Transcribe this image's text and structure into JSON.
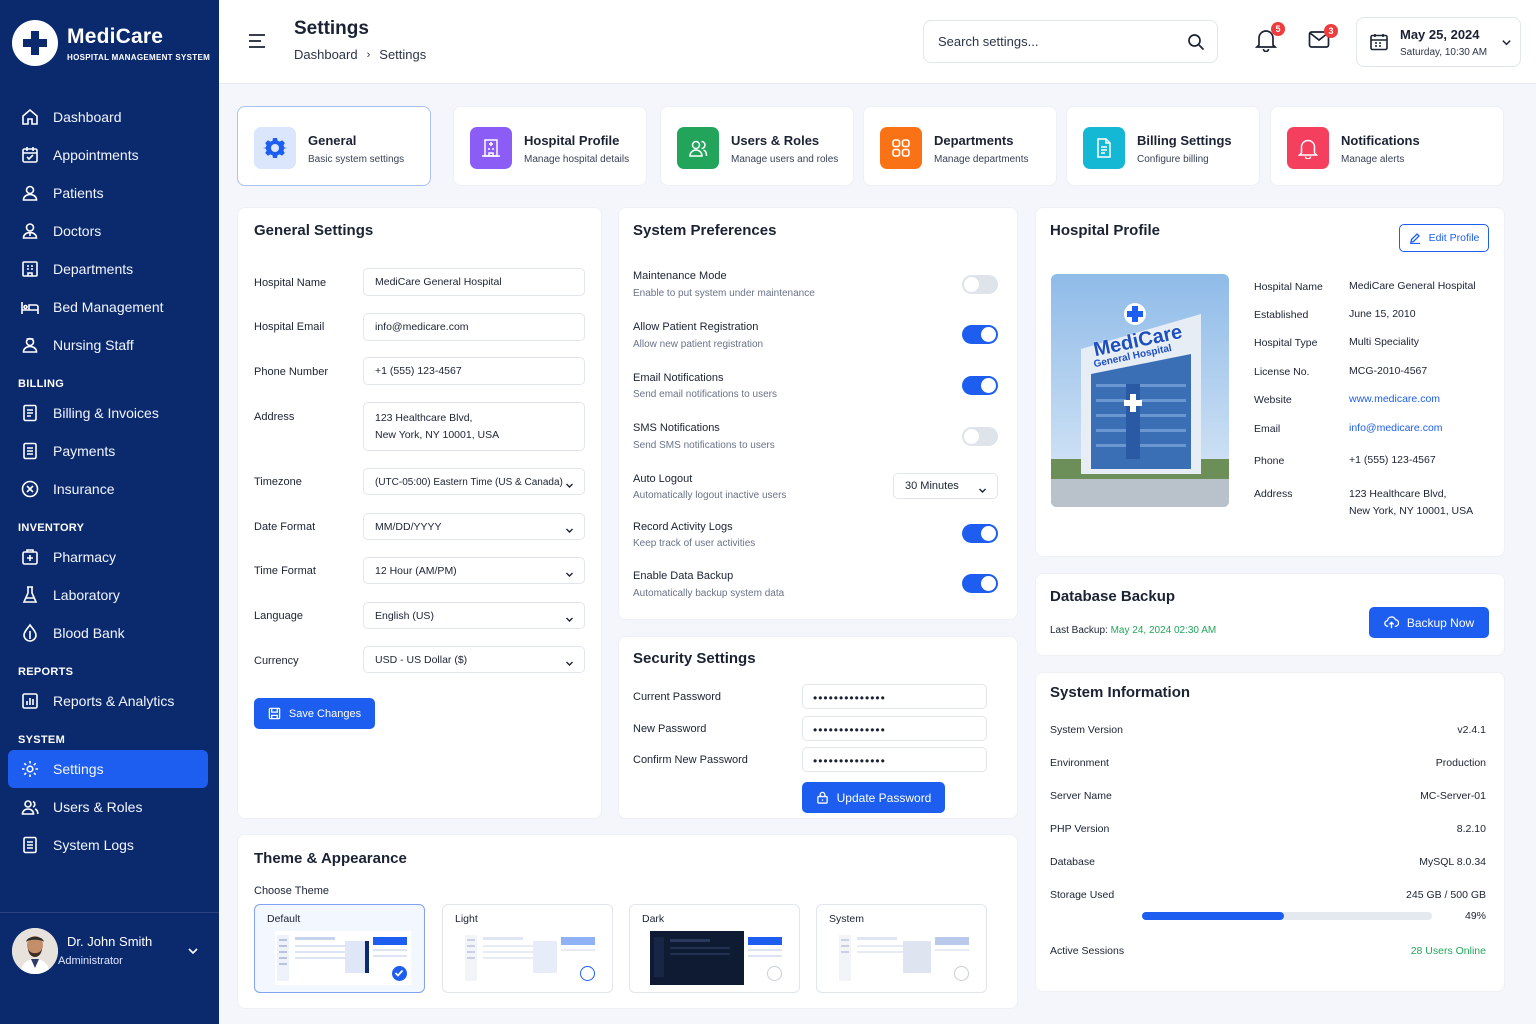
{
  "brand": {
    "name": "MediCare",
    "subtitle": "HOSPITAL MANAGEMENT SYSTEM"
  },
  "sidebar": {
    "main": [
      {
        "label": "Dashboard",
        "icon": "home-icon"
      },
      {
        "label": "Appointments",
        "icon": "calendar-icon"
      },
      {
        "label": "Patients",
        "icon": "user-icon"
      },
      {
        "label": "Doctors",
        "icon": "doctor-icon"
      },
      {
        "label": "Departments",
        "icon": "building-icon"
      },
      {
        "label": "Bed Management",
        "icon": "bed-icon"
      },
      {
        "label": "Nursing Staff",
        "icon": "nurse-icon"
      }
    ],
    "billing_title": "BILLING",
    "billing": [
      {
        "label": "Billing & Invoices",
        "icon": "invoice-icon"
      },
      {
        "label": "Payments",
        "icon": "receipt-icon"
      },
      {
        "label": "Insurance",
        "icon": "insurance-icon"
      }
    ],
    "inventory_title": "INVENTORY",
    "inventory": [
      {
        "label": "Pharmacy",
        "icon": "pharmacy-icon"
      },
      {
        "label": "Laboratory",
        "icon": "flask-icon"
      },
      {
        "label": "Blood Bank",
        "icon": "drop-icon"
      }
    ],
    "reports_title": "REPORTS",
    "reports": [
      {
        "label": "Reports & Analytics",
        "icon": "chart-icon"
      }
    ],
    "system_title": "SYSTEM",
    "system": [
      {
        "label": "Settings",
        "icon": "gear-icon"
      },
      {
        "label": "Users & Roles",
        "icon": "users-icon"
      },
      {
        "label": "System Logs",
        "icon": "log-icon"
      }
    ]
  },
  "user": {
    "name": "Dr. John Smith",
    "role": "Administrator"
  },
  "header": {
    "title": "Settings",
    "breadcrumb": [
      "Dashboard",
      "Settings"
    ],
    "search_placeholder": "Search settings...",
    "notifications_count": "5",
    "messages_count": "3",
    "date": "May 25, 2024",
    "datetime": "Saturday, 10:30 AM"
  },
  "tabs": [
    {
      "name": "General",
      "desc": "Basic system settings",
      "color": "#1d5ef0"
    },
    {
      "name": "Hospital Profile",
      "desc": "Manage hospital details",
      "color": "#8b5cf6"
    },
    {
      "name": "Users & Roles",
      "desc": "Manage users and roles",
      "color": "#22a55a"
    },
    {
      "name": "Departments",
      "desc": "Manage departments",
      "color": "#f97316"
    },
    {
      "name": "Billing Settings",
      "desc": "Configure billing",
      "color": "#14b8d4"
    },
    {
      "name": "Notifications",
      "desc": "Manage alerts",
      "color": "#f43f5e"
    }
  ],
  "general": {
    "title": "General Settings",
    "fields": [
      {
        "label": "Hospital Name",
        "value": "MediCare General Hospital"
      },
      {
        "label": "Hospital Email",
        "value": "info@medicare.com"
      },
      {
        "label": "Phone Number",
        "value": "+1 (555) 123-4567"
      },
      {
        "label": "Address",
        "line1": "123 Healthcare Blvd,",
        "line2": "New York, NY 10001, USA"
      },
      {
        "label": "Timezone",
        "value": "(UTC-05:00) Eastern Time (US & Canada)"
      },
      {
        "label": "Date Format",
        "value": "MM/DD/YYYY"
      },
      {
        "label": "Time Format",
        "value": "12 Hour (AM/PM)"
      },
      {
        "label": "Language",
        "value": "English (US)"
      },
      {
        "label": "Currency",
        "value": "USD - US Dollar ($)"
      }
    ],
    "save_label": "Save Changes"
  },
  "preferences": {
    "title": "System Preferences",
    "items": [
      {
        "name": "Maintenance Mode",
        "desc": "Enable to put system under maintenance",
        "on": false
      },
      {
        "name": "Allow Patient Registration",
        "desc": "Allow new patient registration",
        "on": true
      },
      {
        "name": "Email Notifications",
        "desc": "Send email notifications to users",
        "on": true
      },
      {
        "name": "SMS Notifications",
        "desc": "Send SMS notifications to users",
        "on": false
      },
      {
        "name": "Auto Logout",
        "desc": "Automatically logout inactive users",
        "select": "30 Minutes"
      },
      {
        "name": "Record Activity Logs",
        "desc": "Keep track of user activities",
        "on": true
      },
      {
        "name": "Enable Data Backup",
        "desc": "Automatically backup system data",
        "on": true
      }
    ]
  },
  "security": {
    "title": "Security Settings",
    "fields": [
      {
        "label": "Current Password",
        "value": "••••••••••••••"
      },
      {
        "label": "New Password",
        "value": "••••••••••••••"
      },
      {
        "label": "Confirm New Password",
        "value": "••••••••••••••"
      }
    ],
    "button": "Update Password"
  },
  "profile": {
    "title": "Hospital Profile",
    "edit_label": "Edit Profile",
    "image_title": "MediCare",
    "image_subtitle": "General Hospital",
    "rows": [
      {
        "label": "Hospital Name",
        "value": "MediCare General Hospital"
      },
      {
        "label": "Established",
        "value": "June 15, 2010"
      },
      {
        "label": "Hospital Type",
        "value": "Multi Speciality"
      },
      {
        "label": "License No.",
        "value": "MCG-2010-4567"
      },
      {
        "label": "Website",
        "value": "www.medicare.com"
      },
      {
        "label": "Email",
        "value": "info@medicare.com"
      },
      {
        "label": "Phone",
        "value": "+1 (555) 123-4567"
      },
      {
        "label": "Address",
        "line1": "123 Healthcare Blvd,",
        "line2": "New York, NY 10001, USA"
      }
    ]
  },
  "backup": {
    "title": "Database Backup",
    "last_label": "Last Backup:",
    "last_value": "May 24, 2024 02:30 AM",
    "button": "Backup Now"
  },
  "sysinfo": {
    "title": "System Information",
    "rows": [
      {
        "label": "System Version",
        "value": "v2.4.1"
      },
      {
        "label": "Environment",
        "value": "Production"
      },
      {
        "label": "Server Name",
        "value": "MC-Server-01"
      },
      {
        "label": "PHP Version",
        "value": "8.2.10"
      },
      {
        "label": "Database",
        "value": "MySQL 8.0.34"
      },
      {
        "label": "Storage Used",
        "value": "245 GB / 500 GB"
      }
    ],
    "storage_percent_label": "49%",
    "storage_fraction": 0.49,
    "sessions_label": "Active Sessions",
    "sessions_value": "28 Users Online"
  },
  "theme": {
    "title": "Theme & Appearance",
    "choose": "Choose Theme",
    "options": [
      "Default",
      "Light",
      "Dark",
      "System"
    ],
    "selected": "Default"
  },
  "colors": {
    "primary": "#1d5ef0",
    "sidebar": "#0b2a6e",
    "success": "#22a55a",
    "danger": "#ef3b3b"
  }
}
